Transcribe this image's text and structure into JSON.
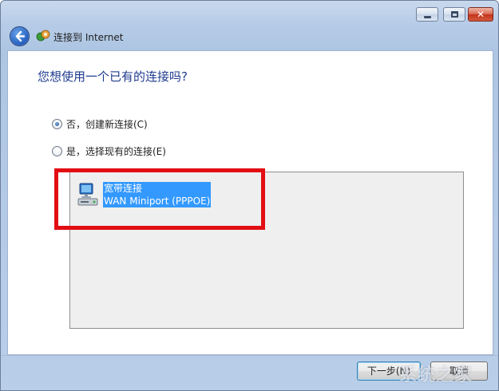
{
  "window": {
    "title": "连接到 Internet",
    "close_glyph": "✕"
  },
  "content": {
    "question": "您想使用一个已有的连接吗?",
    "options": [
      {
        "label": "否，创建新连接(C)",
        "checked": true
      },
      {
        "label": "是，选择现有的连接(E)",
        "checked": false
      }
    ],
    "connections": [
      {
        "name": "宽带连接",
        "device": "WAN Miniport (PPPOE)",
        "icon": "network-computer-icon"
      }
    ]
  },
  "footer": {
    "next_label": "下一步(N)",
    "cancel_label": "取消"
  },
  "watermark": "系统之家",
  "colors": {
    "accent": "#3399ff",
    "heading": "#1f3b8f",
    "highlight": "#e20e13"
  }
}
